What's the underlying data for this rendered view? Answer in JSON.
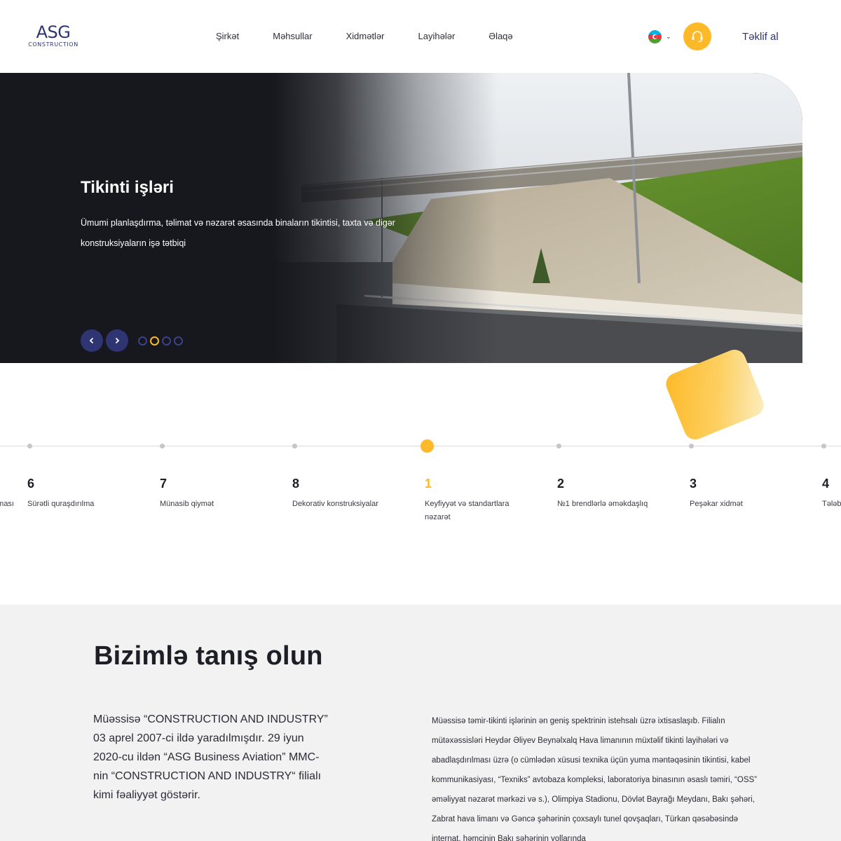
{
  "header": {
    "logo_mark": "ASG",
    "logo_sub": "CONSTRUCTION",
    "nav": [
      "Şirkət",
      "Məhsullar",
      "Xidmətlər",
      "Layihələr",
      "Əlaqə"
    ],
    "cta_label": "Təklif al",
    "accent_color": "#fdb927",
    "brand_color": "#2f3572"
  },
  "hero": {
    "title": "Tikinti işləri",
    "text": "Ümumi planlaşdırma, təlimat və nəzarət əsasında binaların tikintisi, taxta və digər konstruksiyaların işə tətbiqi",
    "slides_count": 4,
    "active_slide": 2
  },
  "timeline": {
    "items": [
      {
        "num": "",
        "label": "ması"
      },
      {
        "num": "6",
        "label": "Sürətli quraşdırılma"
      },
      {
        "num": "7",
        "label": "Münasib qiymət"
      },
      {
        "num": "8",
        "label": "Dekorativ konstruksiyalar"
      },
      {
        "num": "1",
        "label": "Keyfiyyət və standartlara nəzarət"
      },
      {
        "num": "2",
        "label": "№1 brendlərlə əməkdaşlıq"
      },
      {
        "num": "3",
        "label": "Peşəkar xidmət"
      },
      {
        "num": "4",
        "label": "Tələb"
      }
    ],
    "active_index": 4
  },
  "about": {
    "title": "Bizimlə tanış olun",
    "lead": "Müəssisə “CONSTRUCTION AND INDUSTRY” 03 aprel 2007-ci ildə yaradılmışdır. 29 iyun 2020-cu ildən “ASG Business Aviation” MMC-nin “CONSTRUCTION AND INDUSTRY“ filialı kimi fəaliyyət göstərir.",
    "body": "Müəssisə təmir-tikinti işlərinin ən geniş spektrinin istehsalı üzrə ixtisaslaşıb. Filialın mütəxəssisləri Heydər Əliyev Beynəlxalq Hava limanının müxtəlif tikinti layihələri və abadlaşdırılması üzrə (o cümlədən xüsusi texnika üçün yuma məntəqəsinin tikintisi, kabel kommunikasiyası, “Texniks” avtobaza kompleksi, laboratoriya binasının əsaslı təmiri, “OSS” əməliyyat nəzarət mərkəzi və s.), Olimpiya Stadionu, Dövlət Bayrağı Meydanı, Bakı şəhəri, Zabrat hava limanı və Gəncə şəhərinin çoxsaylı tunel qovşaqları, Türkan qəsəbəsində internat, həmçinin Bakı şəhərinin yollarında"
  }
}
